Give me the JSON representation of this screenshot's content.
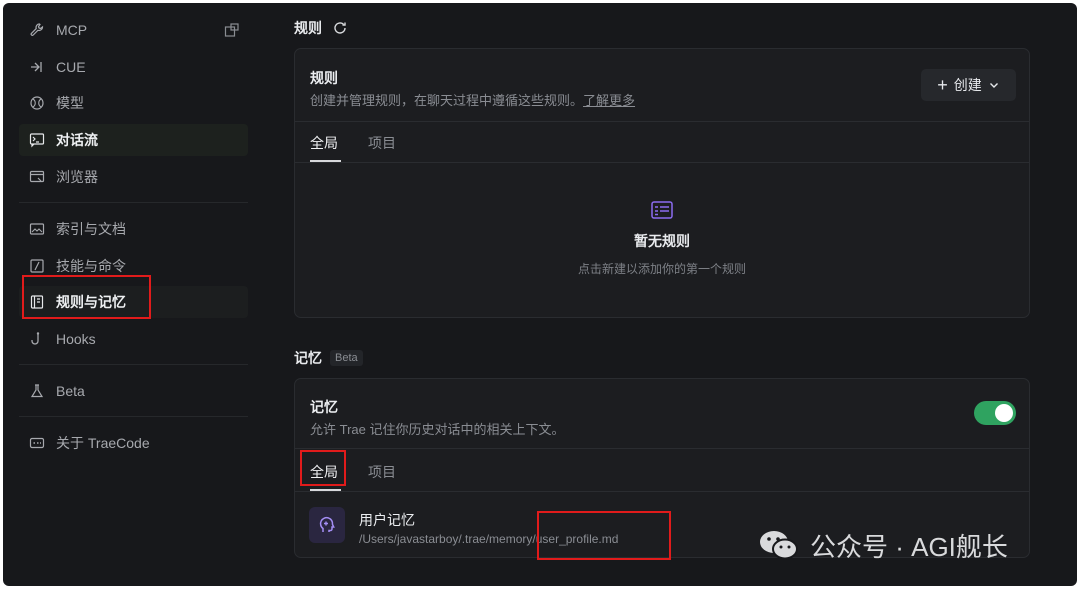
{
  "sidebar": {
    "items": [
      {
        "label": "MCP",
        "icon": "wrench-icon"
      },
      {
        "label": "CUE",
        "icon": "cue-icon"
      },
      {
        "label": "模型",
        "icon": "globe-icon"
      },
      {
        "label": "对话流",
        "icon": "chat-terminal-icon"
      },
      {
        "label": "浏览器",
        "icon": "browser-icon"
      },
      {
        "label": "索引与文档",
        "icon": "folder-image-icon"
      },
      {
        "label": "技能与命令",
        "icon": "slash-box-icon"
      },
      {
        "label": "规则与记忆",
        "icon": "book-icon"
      },
      {
        "label": "Hooks",
        "icon": "hook-icon"
      },
      {
        "label": "Beta",
        "icon": "flask-icon"
      },
      {
        "label": "关于 TraeCode",
        "icon": "id-card-icon"
      }
    ]
  },
  "rules": {
    "section_title": "规则",
    "panel_title": "规则",
    "description": "创建并管理规则，在聊天过程中遵循这些规则。",
    "learn_more": "了解更多",
    "create_button": "创建",
    "tabs": [
      "全局",
      "项目"
    ],
    "empty_title": "暂无规则",
    "empty_desc": "点击新建以添加你的第一个规则"
  },
  "memory": {
    "section_title": "记忆",
    "beta_badge": "Beta",
    "panel_title": "记忆",
    "description": "允许 Trae 记住你历史对话中的相关上下文。",
    "toggle_on": true,
    "tabs": [
      "全局",
      "项目"
    ],
    "item": {
      "title": "用户记忆",
      "path": "/Users/javastarboy/.trae/memory/user_profile.md"
    }
  },
  "watermark": {
    "text": "公众号 · AGI舰长"
  },
  "colors": {
    "accent_green": "#2fa360",
    "highlight_red": "#e11b1b",
    "purple_icon": "#8b6cf0"
  }
}
